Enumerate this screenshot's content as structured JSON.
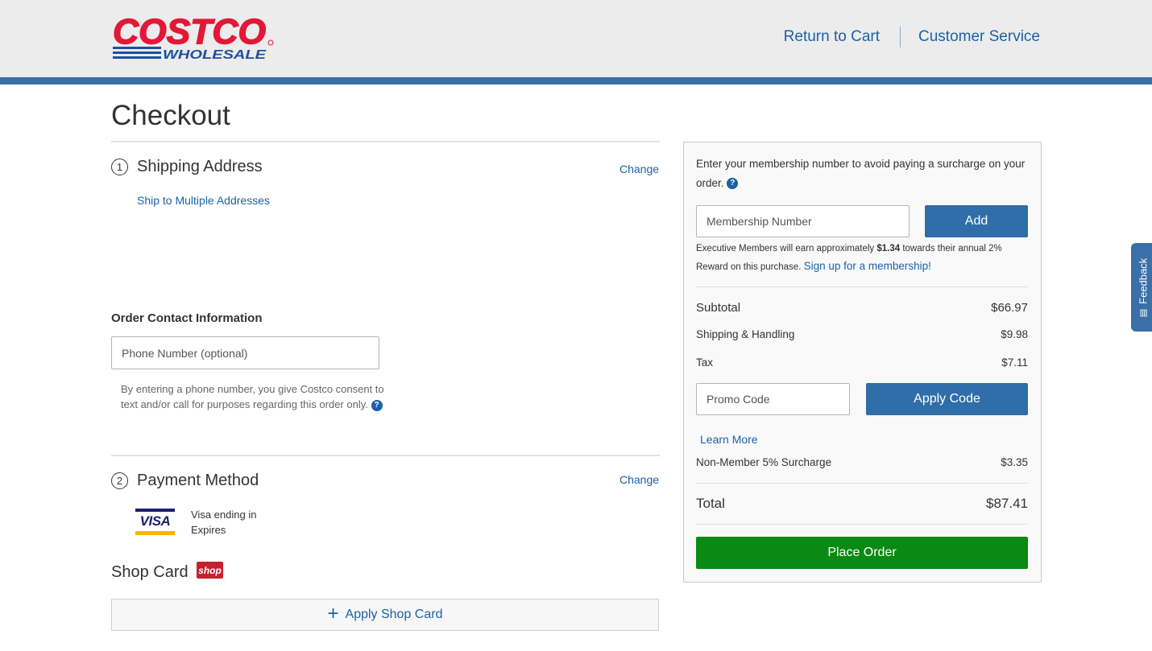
{
  "header": {
    "logo_top": "COSTCO",
    "logo_bottom": "WHOLESALE",
    "return_to_cart": "Return to Cart",
    "customer_service": "Customer Service"
  },
  "page_title": "Checkout",
  "shipping": {
    "step_number": "1",
    "title": "Shipping Address",
    "change": "Change",
    "multiple_addresses": "Ship to Multiple Addresses"
  },
  "contact": {
    "title": "Order Contact Information",
    "phone_placeholder": "Phone Number (optional)",
    "consent_text": "By entering a phone number, you give Costco consent to text and/or call for purposes regarding this order only."
  },
  "payment": {
    "step_number": "2",
    "title": "Payment Method",
    "change": "Change",
    "card_brand": "VISA",
    "card_line1": "Visa ending in",
    "card_line2": "Expires"
  },
  "shop_card": {
    "title": "Shop Card",
    "badge": "shop",
    "apply_label": "Apply Shop Card"
  },
  "summary": {
    "membership_prompt": "Enter your membership number to avoid paying a surcharge on your order.",
    "membership_placeholder": "Membership Number",
    "add_button": "Add",
    "exec_text_1": "Executive Members will earn approximately",
    "exec_amount": "$1.34",
    "exec_text_2": "towards their annual 2% Reward on this purchase.",
    "signup_link": "Sign up for a membership!",
    "subtotal_label": "Subtotal",
    "subtotal_value": "$66.97",
    "shipping_label": "Shipping & Handling",
    "shipping_value": "$9.98",
    "tax_label": "Tax",
    "tax_value": "$7.11",
    "promo_placeholder": "Promo Code",
    "apply_code": "Apply Code",
    "learn_more": "Learn More",
    "surcharge_label": "Non-Member 5% Surcharge",
    "surcharge_value": "$3.35",
    "total_label": "Total",
    "total_value": "$87.41",
    "place_order": "Place Order"
  },
  "feedback": {
    "label": "Feedback"
  },
  "colors": {
    "brand_blue": "#3a6fa8",
    "link_blue": "#1b61a8",
    "costco_red": "#e31837",
    "place_order_green": "#0a8a12"
  }
}
